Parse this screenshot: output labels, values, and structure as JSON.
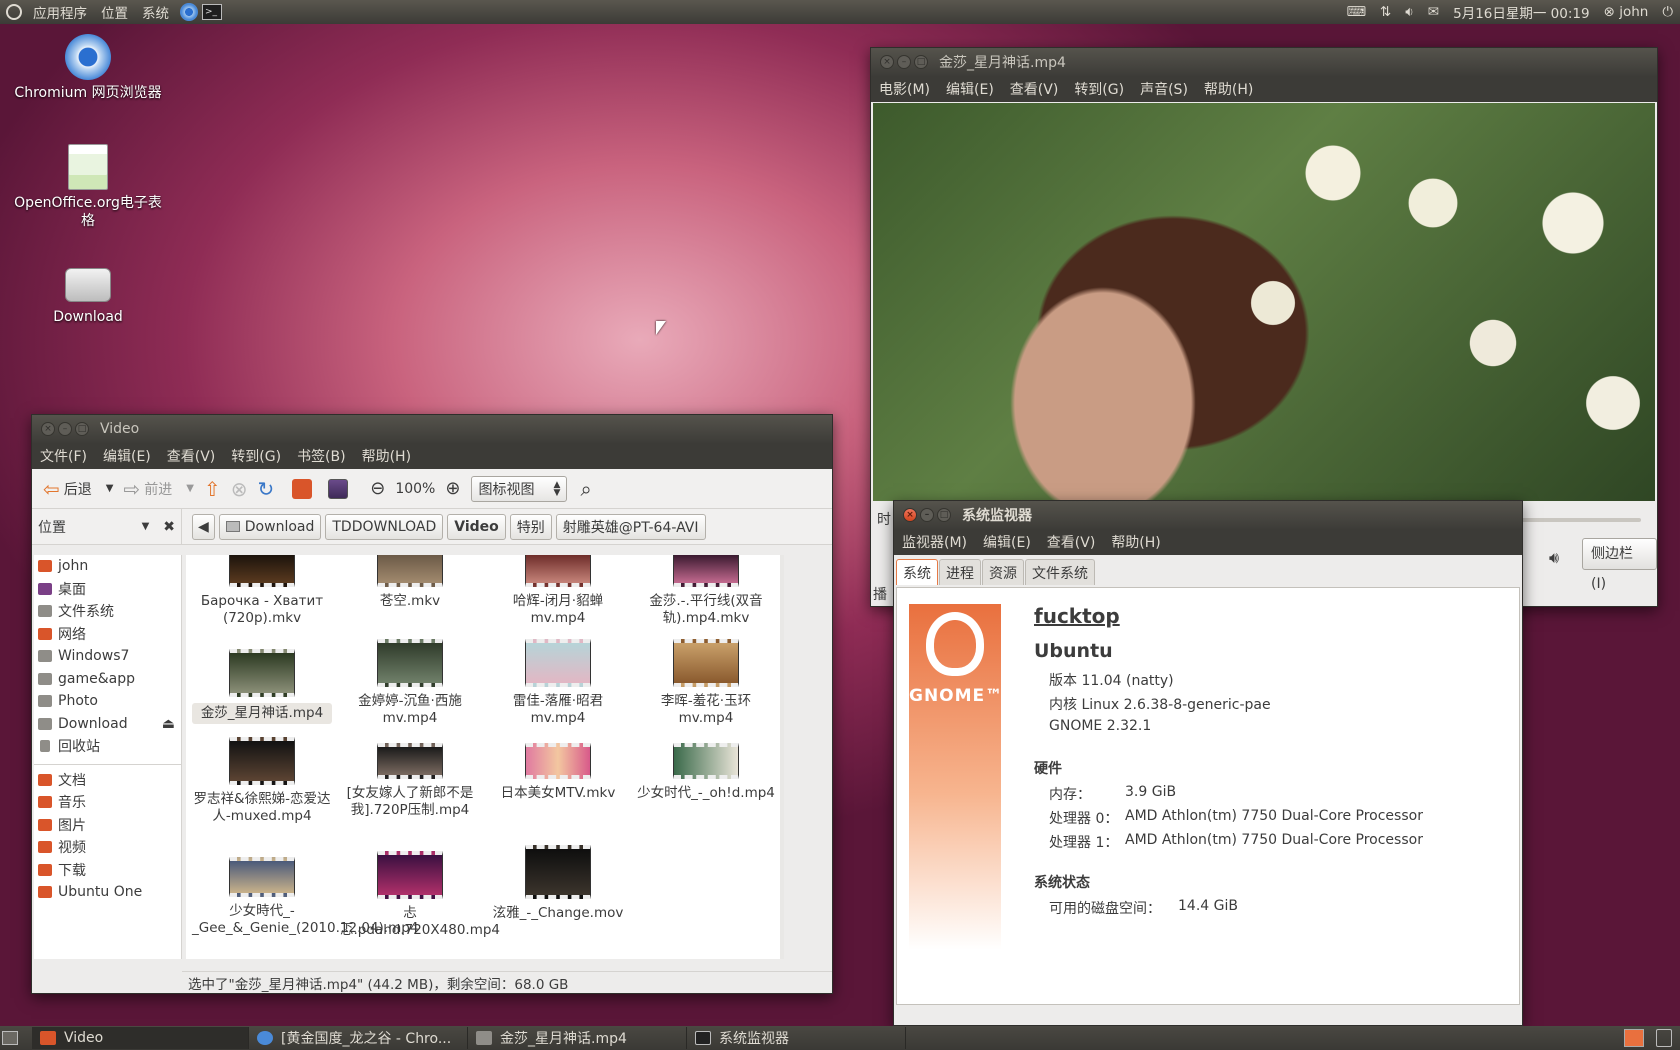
{
  "top_panel": {
    "menus": [
      "应用程序",
      "位置",
      "系统"
    ],
    "datetime": "5月16日星期一 00:19",
    "user": "john"
  },
  "desktop_icons": [
    {
      "label": "Chromium 网页浏览器",
      "icon": "chromium-icon"
    },
    {
      "label": "OpenOffice.org电子表格",
      "icon": "spreadsheet-icon"
    },
    {
      "label": "Download",
      "icon": "drive-icon"
    }
  ],
  "video_player": {
    "title": "金莎_星月神话.mp4",
    "menus": [
      "电影(M)",
      "编辑(E)",
      "查看(V)",
      "转到(G)",
      "声音(S)",
      "帮助(H)"
    ],
    "time_label_partial": "时",
    "status_partial": "播",
    "sidebar_button": "侧边栏(I)"
  },
  "file_manager": {
    "title": "Video",
    "menus": [
      "文件(F)",
      "编辑(E)",
      "查看(V)",
      "转到(G)",
      "书签(B)",
      "帮助(H)"
    ],
    "toolbar": {
      "back": "后退",
      "forward": "前进",
      "zoom": "100%",
      "view_mode": "图标视图"
    },
    "sidebar_title": "位置",
    "breadcrumbs": [
      "Download",
      "TDDOWNLOAD",
      "Video",
      "特别",
      "射雕英雄@PT-64-AVI"
    ],
    "places": [
      "john",
      "桌面",
      "文件系统",
      "网络",
      "Windows7",
      "game&app",
      "Photo",
      "Download",
      "回收站"
    ],
    "bookmarks": [
      "文档",
      "音乐",
      "图片",
      "视频",
      "下载",
      "Ubuntu One"
    ],
    "files": [
      {
        "name": "Барочка - Хватит (720p).mkv",
        "selected": false
      },
      {
        "name": "苍空.mkv",
        "selected": false
      },
      {
        "name": "哈辉-闭月·貂蝉mv.mp4",
        "selected": false
      },
      {
        "name": "金莎.-.平行线(双音轨).mp4.mkv",
        "selected": false
      },
      {
        "name": "金莎_星月神话.mp4",
        "selected": true
      },
      {
        "name": "金婷婷-沉鱼·西施mv.mp4",
        "selected": false
      },
      {
        "name": "雷佳-落雁·昭君mv.mp4",
        "selected": false
      },
      {
        "name": "李晖-羞花·玉环mv.mp4",
        "selected": false
      },
      {
        "name": "罗志祥&徐熙娣-恋爱达人-muxed.mp4",
        "selected": false
      },
      {
        "name": "[女友嫁人了新郎不是我].720P压制.mp4",
        "selected": false
      },
      {
        "name": "日本美女MTV.mkv",
        "selected": false
      },
      {
        "name": "少女时代_-_oh!d.mp4",
        "selected": false
      },
      {
        "name": "少女時代_-_Gee_&_Genie_(2010.12.04).mp4",
        "selected": false
      },
      {
        "name": "忐忑.pdahd.720X480.mp4",
        "selected": false
      },
      {
        "name": "泫雅_-_Change.mov",
        "selected": false
      }
    ],
    "status": "选中了\"金莎_星月神话.mp4\" (44.2 MB)，剩余空间：68.0 GB"
  },
  "system_monitor": {
    "title": "系统监视器",
    "menus": [
      "监视器(M)",
      "编辑(E)",
      "查看(V)",
      "帮助(H)"
    ],
    "tabs": [
      "系统",
      "进程",
      "资源",
      "文件系统"
    ],
    "active_tab": "系统",
    "logo_text": "GNOME™",
    "hostname": "fucktop",
    "os": "Ubuntu",
    "version": "版本 11.04 (natty)",
    "kernel": "内核 Linux 2.6.38-8-generic-pae",
    "gnome": "GNOME 2.32.1",
    "hardware_heading": "硬件",
    "memory_label": "内存：",
    "memory_value": "3.9 GiB",
    "cpu0_label": "处理器 0：",
    "cpu0_value": "AMD Athlon(tm) 7750 Dual-Core Processor",
    "cpu1_label": "处理器 1：",
    "cpu1_value": "AMD Athlon(tm) 7750 Dual-Core Processor",
    "status_heading": "系统状态",
    "disk_label": "可用的磁盘空间：",
    "disk_value": "14.4 GiB"
  },
  "taskbar": [
    {
      "label": "Video",
      "active": true
    },
    {
      "label": "[黄金国度_龙之谷 - Chro...",
      "active": false
    },
    {
      "label": "金莎_星月神话.mp4",
      "active": false
    },
    {
      "label": "系统监视器",
      "active": false
    }
  ]
}
